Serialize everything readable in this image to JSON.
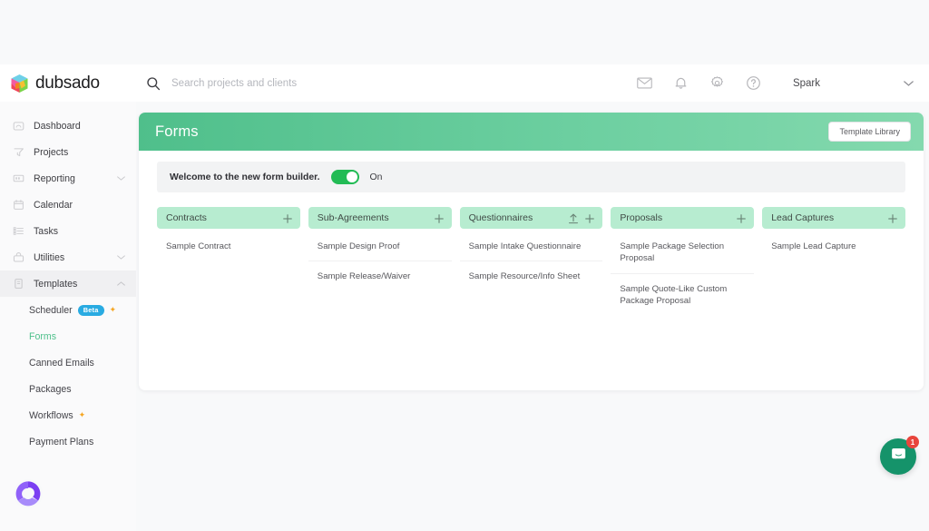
{
  "brand": {
    "name": "dubsado",
    "logo_icon": "dubsado-cube-logo"
  },
  "search": {
    "placeholder": "Search projects and clients",
    "value": "",
    "icon": "search-icon"
  },
  "topbar": {
    "icons": [
      {
        "name": "mail-icon",
        "label": "Mail"
      },
      {
        "name": "bell-icon",
        "label": "Notifications"
      },
      {
        "name": "gear-icon",
        "label": "Settings"
      },
      {
        "name": "help-icon",
        "label": "Help"
      }
    ],
    "user": "Spark",
    "user_chevron": "chevron-down-icon"
  },
  "sidebar": {
    "items": [
      {
        "label": "Dashboard",
        "icon": "dashboard-icon",
        "expandable": false
      },
      {
        "label": "Projects",
        "icon": "projects-icon",
        "expandable": false
      },
      {
        "label": "Reporting",
        "icon": "reporting-icon",
        "expandable": true
      },
      {
        "label": "Calendar",
        "icon": "calendar-icon",
        "expandable": false
      },
      {
        "label": "Tasks",
        "icon": "tasks-icon",
        "expandable": false
      },
      {
        "label": "Utilities",
        "icon": "utilities-icon",
        "expandable": true
      },
      {
        "label": "Templates",
        "icon": "templates-icon",
        "expandable": true,
        "active": true
      }
    ],
    "sub_items": [
      {
        "label": "Scheduler",
        "badge": "Beta",
        "sparkle": "✦",
        "selected": false
      },
      {
        "label": "Forms",
        "selected": true
      },
      {
        "label": "Canned Emails",
        "selected": false
      },
      {
        "label": "Packages",
        "selected": false
      },
      {
        "label": "Workflows",
        "sparkle": "✦",
        "selected": false
      },
      {
        "label": "Payment Plans",
        "selected": false
      }
    ],
    "avatar": "user-avatar"
  },
  "main": {
    "title": "Forms",
    "template_library_label": "Template Library",
    "banner": {
      "text": "Welcome to the new form builder.",
      "toggle_state": "On",
      "toggle_on": true
    },
    "columns": [
      {
        "title": "Contracts",
        "actions": [
          "plus-icon"
        ],
        "entries": [
          "Sample Contract"
        ]
      },
      {
        "title": "Sub-Agreements",
        "actions": [
          "plus-icon"
        ],
        "entries": [
          "Sample Design Proof",
          "Sample Release/Waiver"
        ]
      },
      {
        "title": "Questionnaires",
        "actions": [
          "upload-icon",
          "plus-icon"
        ],
        "entries": [
          "Sample Intake Questionnaire",
          "Sample Resource/Info Sheet"
        ]
      },
      {
        "title": "Proposals",
        "actions": [
          "plus-icon"
        ],
        "entries": [
          "Sample Package Selection Proposal",
          "Sample Quote-Like Custom Package Proposal"
        ]
      },
      {
        "title": "Lead Captures",
        "actions": [
          "plus-icon"
        ],
        "entries": [
          "Sample Lead Capture"
        ]
      }
    ]
  },
  "chat": {
    "icon": "chat-bubble-icon",
    "badge": "1"
  },
  "colors": {
    "header_green_start": "#4fbf8b",
    "header_green_end": "#84d9ae",
    "column_head_green": "#b7ecd0",
    "selected_green": "#4ec08b",
    "toggle_green": "#22bb55",
    "beta_blue": "#29abe2",
    "badge_red": "#e8453c",
    "chat_green": "#15936a",
    "page_bg": "#f8f9fa"
  }
}
